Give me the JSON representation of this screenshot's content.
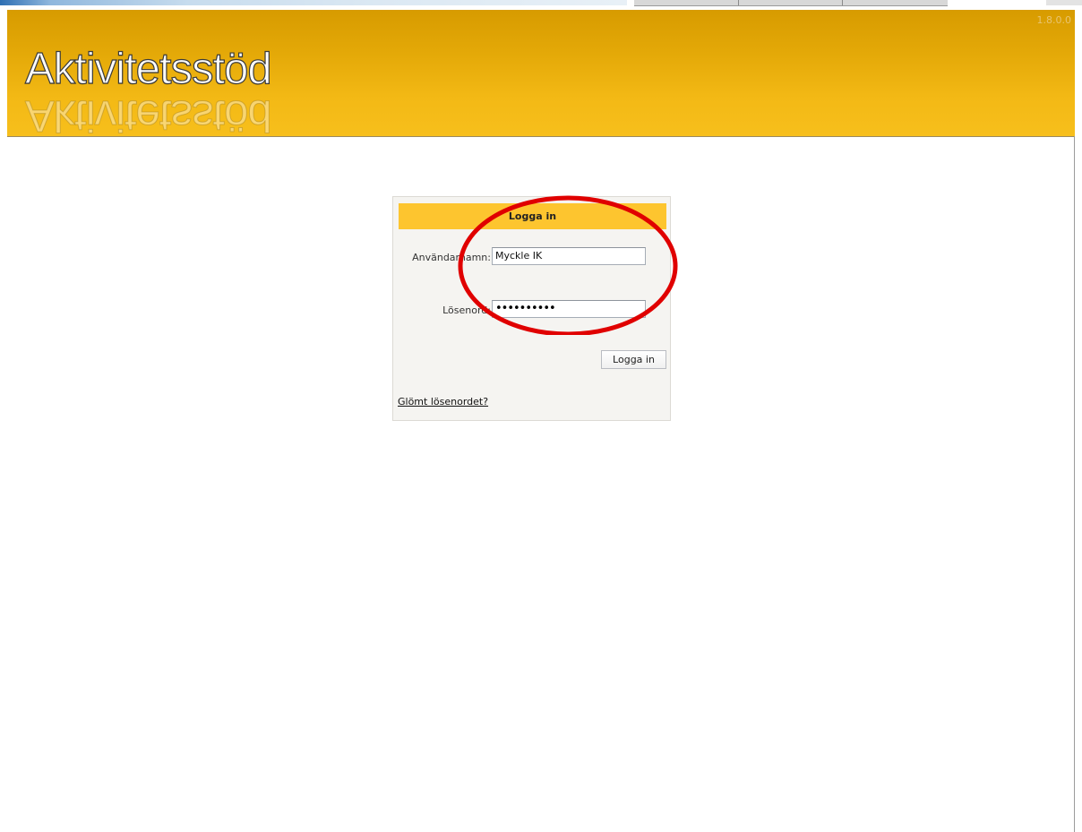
{
  "app": {
    "logo_text": "Aktivitetsstöd",
    "version": "1.8.0.0"
  },
  "login": {
    "title": "Logga in",
    "username_label": "Användarnamn:",
    "username_value": "Myckle IK",
    "password_label": "Lösenord:",
    "password_mask": "••••••••••",
    "submit_label": "Logga in",
    "forgot_link": "Glömt lösenordet?"
  },
  "colors": {
    "header": "#e4a908",
    "title_bar": "#fdc52f",
    "annotation": "#e00000"
  }
}
